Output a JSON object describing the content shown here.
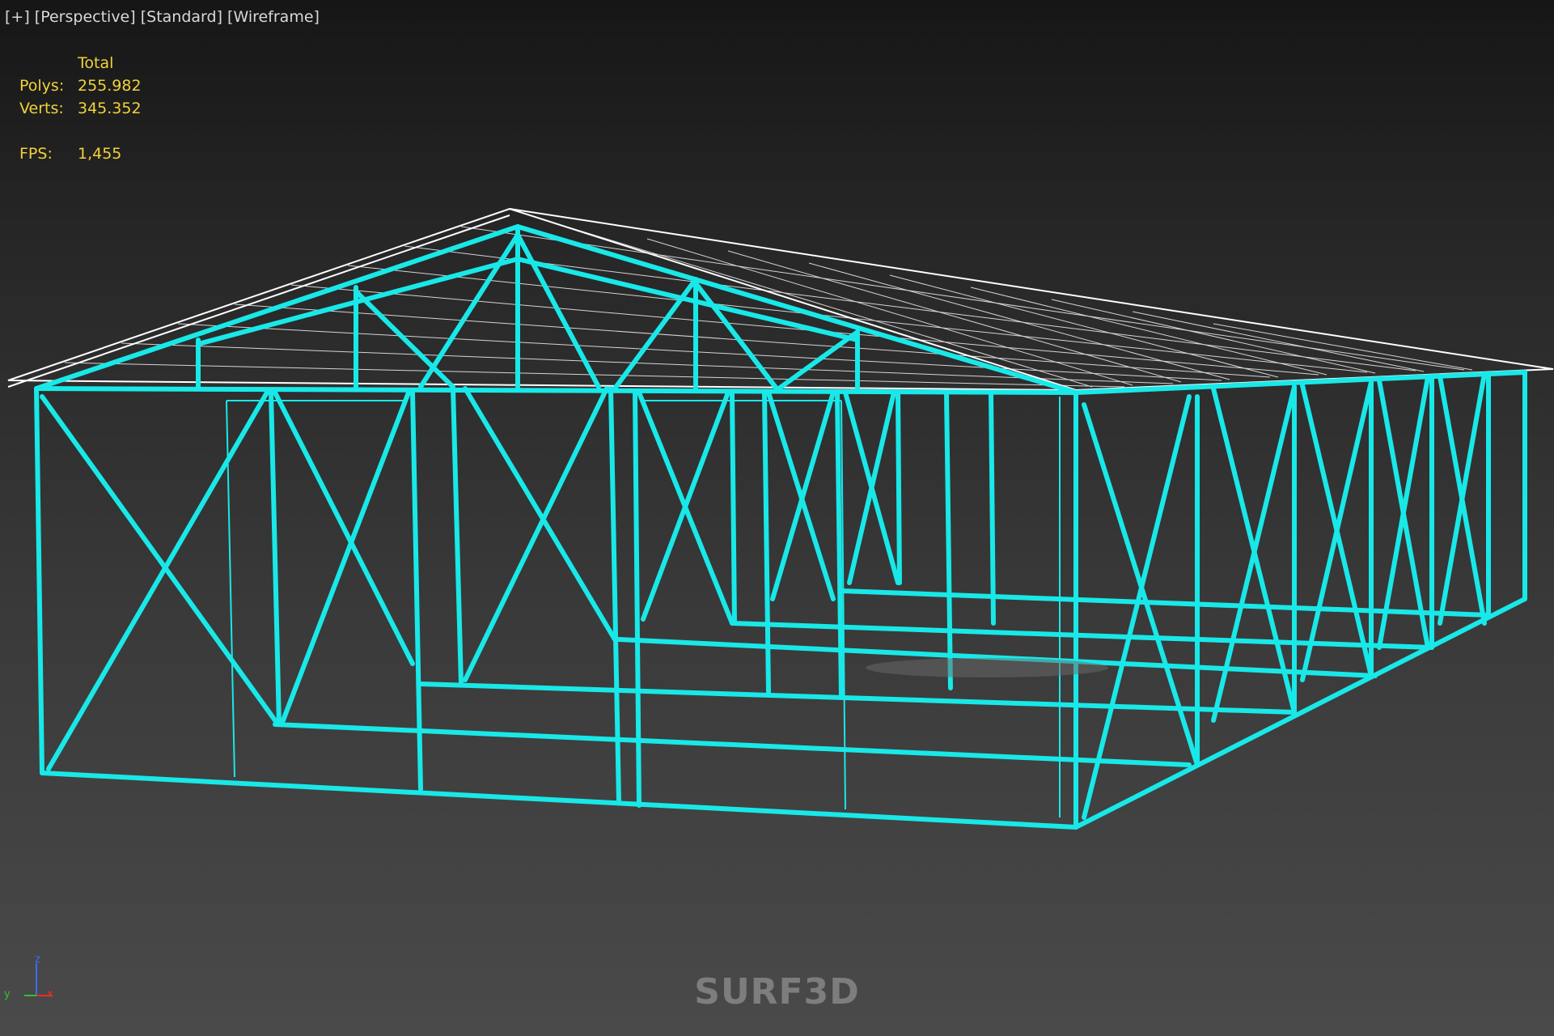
{
  "viewport": {
    "labels": {
      "plus": "[+]",
      "view": "[Perspective]",
      "shading": "[Standard]",
      "mode": "[Wireframe]"
    },
    "stats": {
      "header": "Total",
      "polys_label": "Polys:",
      "polys_value": "255.982",
      "verts_label": "Verts:",
      "verts_value": "345.352",
      "fps_label": "FPS:",
      "fps_value": "1,455"
    },
    "axis": {
      "z": "z",
      "y": "y",
      "x": "x"
    },
    "watermark": "SURF3D"
  },
  "colors": {
    "wire_primary": "#19e8e8",
    "wire_secondary": "#ffffff",
    "stats_text": "#f0d23a",
    "label_text": "#d8d8d8",
    "axis_z": "#3a6dff",
    "axis_x": "#e03030",
    "axis_y": "#30c030"
  },
  "icons": [
    "axis-gizmo-icon"
  ]
}
